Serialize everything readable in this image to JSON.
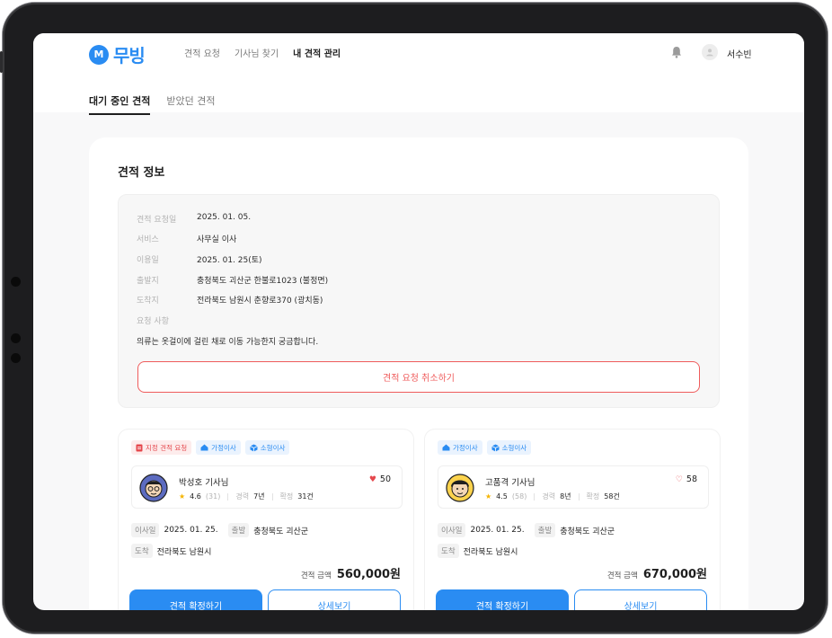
{
  "header": {
    "logo_mark": "M",
    "logo_text": "무빙",
    "nav": [
      "견적 요청",
      "기사님 찾기",
      "내 견적 관리"
    ],
    "user_name": "서수빈"
  },
  "tabs": [
    "대기 중인 견적",
    "받았던 견적"
  ],
  "panel": {
    "title": "견적 정보",
    "info": [
      {
        "label": "견적 요청일",
        "value": "2025. 01. 05."
      },
      {
        "label": "서비스",
        "value": "사무실 이사"
      },
      {
        "label": "이용일",
        "value": "2025. 01. 25(토)"
      },
      {
        "label": "출발지",
        "value": "충청북도 괴산군 한불로1023 (불정면)"
      },
      {
        "label": "도착지",
        "value": "전라북도 남원시 춘향로370 (광치동)"
      },
      {
        "label": "요청 사항",
        "value": ""
      }
    ],
    "note": "의류는 옷걸이에 걸린 채로 이동 가능한지 궁금합니다.",
    "cancel_label": "견적 요청 취소하기"
  },
  "quotes": [
    {
      "badges": [
        "지정 견적 요청",
        "가정이사",
        "소형이사"
      ],
      "driver": "박성호 기사님",
      "rating": "4.6",
      "reviews": "(31)",
      "career_label": "경력",
      "career": "7년",
      "confirmed_label": "확정",
      "confirmed": "31건",
      "likes": "50",
      "liked": true,
      "move_label": "이사일",
      "move_date": "2025. 01. 25.",
      "from_label": "출발",
      "from": "충청북도 괴산군",
      "to_label": "도착",
      "to": "전라북도 남원시",
      "price_label": "견적 금액",
      "price": "560,000원",
      "confirm_label": "견적 확정하기",
      "detail_label": "상세보기"
    },
    {
      "badges": [
        "가정이사",
        "소형이사"
      ],
      "driver": "고품격 기사님",
      "rating": "4.5",
      "reviews": "(58)",
      "career_label": "경력",
      "career": "8년",
      "confirmed_label": "확정",
      "confirmed": "58건",
      "likes": "58",
      "liked": false,
      "move_label": "이사일",
      "move_date": "2025. 01. 25.",
      "from_label": "출발",
      "from": "충청북도 괴산군",
      "to_label": "도착",
      "to": "전라북도 남원시",
      "price_label": "견적 금액",
      "price": "670,000원",
      "confirm_label": "견적 확정하기",
      "detail_label": "상세보기"
    }
  ],
  "colors": {
    "accent": "#2a8cf2",
    "danger": "#e5484d",
    "star": "#f5b400"
  }
}
